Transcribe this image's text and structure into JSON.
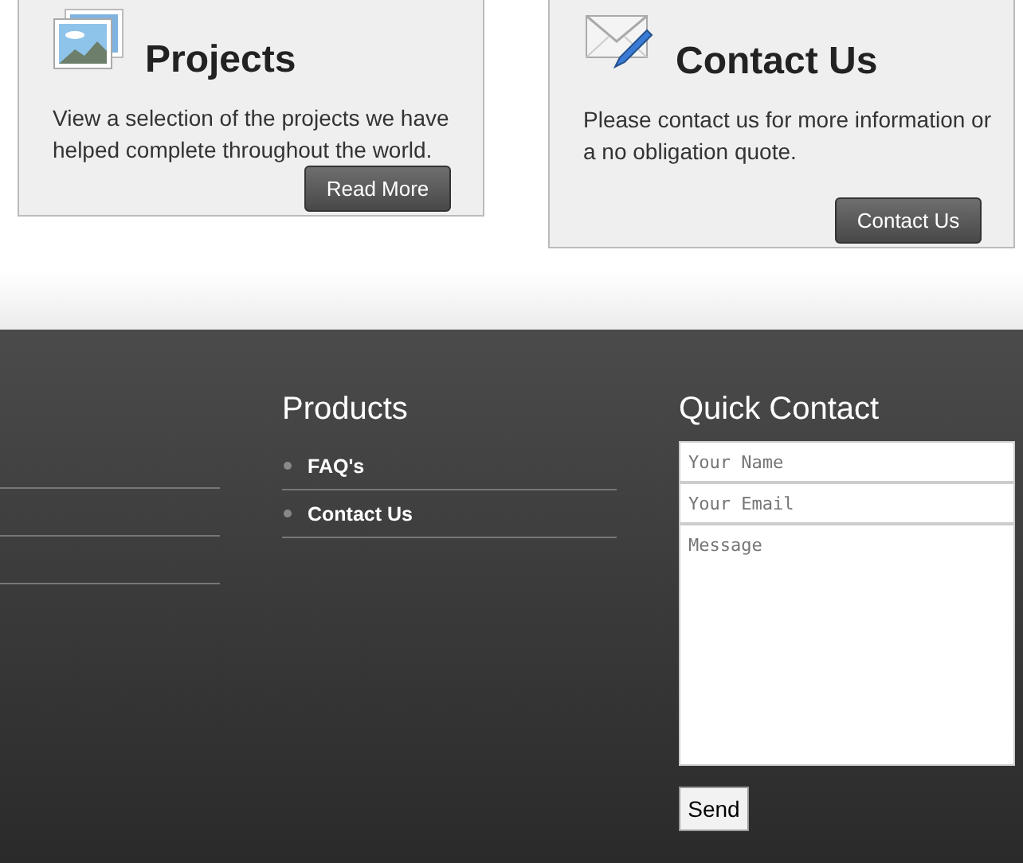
{
  "cards": [
    {
      "kind": "pictures",
      "title": "Projects",
      "text": "View a selection of the projects we have helped complete throughout the world.",
      "button": "Read More"
    },
    {
      "kind": "mail",
      "title": "Contact Us",
      "text": "Please contact us for more information or a no obligation quote.",
      "button": "Contact Us"
    }
  ],
  "footer": {
    "products": {
      "title": "Products",
      "items": [
        "FAQ's",
        "Contact Us"
      ]
    },
    "quick_contact": {
      "title": "Quick Contact",
      "fields": [
        {
          "kind": "input",
          "placeholder": "Your Name"
        },
        {
          "kind": "input",
          "placeholder": "Your Email"
        },
        {
          "kind": "textarea",
          "placeholder": "Message"
        }
      ],
      "button": "Send"
    }
  }
}
